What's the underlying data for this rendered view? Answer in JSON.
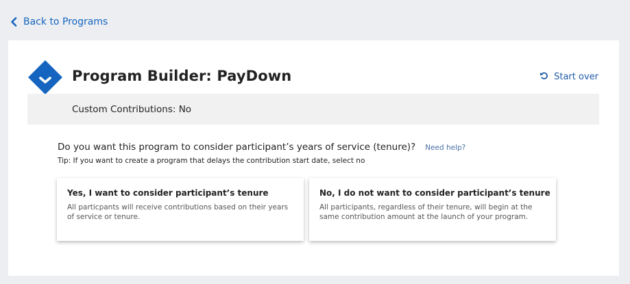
{
  "nav": {
    "back_label": "Back to Programs"
  },
  "header": {
    "title": "Program Builder: PayDown",
    "start_over_label": "Start over"
  },
  "banner": {
    "text": "Custom Contributions: No"
  },
  "question": {
    "text": "Do you want this program to consider participant’s years of service (tenure)?",
    "help_label": "Need help?",
    "tip": "Tip: If you want to create a program that delays the contribution start date, select no"
  },
  "options": [
    {
      "title": "Yes, I want to consider participant’s tenure",
      "description": "All particpants will receive contributions based on their years of service or tenure."
    },
    {
      "title": "No, I do not want to consider participant’s tenure",
      "description": "All participants, regardless of their tenure, will begin at the same contribution amount at the launch of your program."
    }
  ],
  "colors": {
    "accent": "#1565c0",
    "banner_bg": "#f1f1f1",
    "page_bg": "#eceef1"
  },
  "icons": {
    "back": "chevron-left-icon",
    "logo": "diamond-chevron-logo",
    "start_over": "restart-icon"
  }
}
